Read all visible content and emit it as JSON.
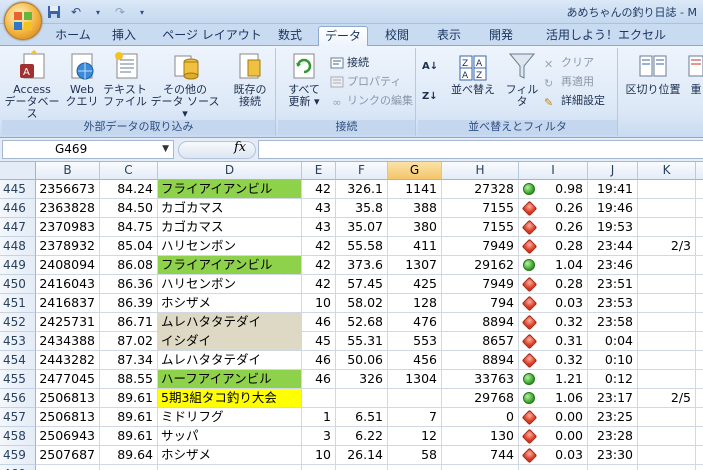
{
  "window": {
    "title": "あめちゃんの釣り日誌 - M"
  },
  "qat_icons": [
    "save-icon",
    "undo-icon",
    "redo-icon",
    "customize-icon"
  ],
  "tabs": [
    "ホーム",
    "挿入",
    "ページ レイアウト",
    "数式",
    "データ",
    "校閲",
    "表示",
    "開発",
    "活用しよう！エクセル"
  ],
  "active_tab": "データ",
  "ribbon": {
    "external": {
      "label": "外部データの取り込み",
      "access_l1": "Access",
      "access_l2": "データベース",
      "web_l1": "Web",
      "web_l2": "クエリ",
      "text_l1": "テキスト",
      "text_l2": "ファイル",
      "other_l1": "その他の",
      "other_l2": "データ ソース ▾",
      "existing_l1": "既存の",
      "existing_l2": "接続"
    },
    "connections": {
      "label": "接続",
      "refresh_l1": "すべて",
      "refresh_l2": "更新 ▾",
      "conn": "接続",
      "props": "プロパティ",
      "links": "リンクの編集"
    },
    "sort": {
      "label": "並べ替えとフィルタ",
      "sort_btn": "並べ替え",
      "filter": "フィルタ",
      "clear": "クリア",
      "reapply": "再適用",
      "advanced": "詳細設定"
    },
    "tools": {
      "split": "区切り位置",
      "dup": "重"
    }
  },
  "formula": {
    "cell_ref": "G469",
    "fx": "fx",
    "value": ""
  },
  "columns": [
    "B",
    "C",
    "D",
    "E",
    "F",
    "G",
    "H",
    "I",
    "J",
    "K"
  ],
  "selected_column": "G",
  "rows": [
    {
      "n": "445",
      "b": "2356673",
      "c": "84.24",
      "d": "フライアイアンビル",
      "dc": "green",
      "e": "42",
      "f": "326.1",
      "g": "1141",
      "h": "27328",
      "dir": "up",
      "i": "0.98",
      "j": "19:41",
      "k": ""
    },
    {
      "n": "446",
      "b": "2363828",
      "c": "84.50",
      "d": "カゴカマス",
      "dc": "",
      "e": "43",
      "f": "35.8",
      "g": "388",
      "h": "7155",
      "dir": "down",
      "i": "0.26",
      "j": "19:46",
      "k": ""
    },
    {
      "n": "447",
      "b": "2370983",
      "c": "84.75",
      "d": "カゴカマス",
      "dc": "",
      "e": "43",
      "f": "35.07",
      "g": "380",
      "h": "7155",
      "dir": "down",
      "i": "0.26",
      "j": "19:53",
      "k": ""
    },
    {
      "n": "448",
      "b": "2378932",
      "c": "85.04",
      "d": "ハリセンボン",
      "dc": "",
      "e": "42",
      "f": "55.58",
      "g": "411",
      "h": "7949",
      "dir": "down",
      "i": "0.28",
      "j": "23:44",
      "k": "2/3"
    },
    {
      "n": "449",
      "b": "2408094",
      "c": "86.08",
      "d": "フライアイアンビル",
      "dc": "green",
      "e": "42",
      "f": "373.6",
      "g": "1307",
      "h": "29162",
      "dir": "up",
      "i": "1.04",
      "j": "23:46",
      "k": ""
    },
    {
      "n": "450",
      "b": "2416043",
      "c": "86.36",
      "d": "ハリセンボン",
      "dc": "",
      "e": "42",
      "f": "57.45",
      "g": "425",
      "h": "7949",
      "dir": "down",
      "i": "0.28",
      "j": "23:51",
      "k": ""
    },
    {
      "n": "451",
      "b": "2416837",
      "c": "86.39",
      "d": "ホシザメ",
      "dc": "",
      "e": "10",
      "f": "58.02",
      "g": "128",
      "h": "794",
      "dir": "down",
      "i": "0.03",
      "j": "23:53",
      "k": ""
    },
    {
      "n": "452",
      "b": "2425731",
      "c": "86.71",
      "d": "ムレハタタテダイ",
      "dc": "tan",
      "e": "46",
      "f": "52.68",
      "g": "476",
      "h": "8894",
      "dir": "down",
      "i": "0.32",
      "j": "23:58",
      "k": ""
    },
    {
      "n": "453",
      "b": "2434388",
      "c": "87.02",
      "d": "イシダイ",
      "dc": "tan",
      "e": "45",
      "f": "55.31",
      "g": "553",
      "h": "8657",
      "dir": "down",
      "i": "0.31",
      "j": "0:04",
      "k": ""
    },
    {
      "n": "454",
      "b": "2443282",
      "c": "87.34",
      "d": "ムレハタタテダイ",
      "dc": "",
      "e": "46",
      "f": "50.06",
      "g": "456",
      "h": "8894",
      "dir": "down",
      "i": "0.32",
      "j": "0:10",
      "k": ""
    },
    {
      "n": "455",
      "b": "2477045",
      "c": "88.55",
      "d": "ハーフアイアンビル",
      "dc": "green",
      "e": "46",
      "f": "326",
      "g": "1304",
      "h": "33763",
      "dir": "up",
      "i": "1.21",
      "j": "0:12",
      "k": ""
    },
    {
      "n": "456",
      "b": "2506813",
      "c": "89.61",
      "d": "5期3組タコ釣り大会",
      "dc": "yellow",
      "e": "",
      "f": "",
      "g": "",
      "h": "29768",
      "dir": "up",
      "i": "1.06",
      "j": "23:17",
      "k": "2/5"
    },
    {
      "n": "457",
      "b": "2506813",
      "c": "89.61",
      "d": "ミドリフグ",
      "dc": "",
      "e": "1",
      "f": "6.51",
      "g": "7",
      "h": "0",
      "dir": "down",
      "i": "0.00",
      "j": "23:25",
      "k": ""
    },
    {
      "n": "458",
      "b": "2506943",
      "c": "89.61",
      "d": "サッパ",
      "dc": "",
      "e": "3",
      "f": "6.22",
      "g": "12",
      "h": "130",
      "dir": "down",
      "i": "0.00",
      "j": "23:28",
      "k": ""
    },
    {
      "n": "459",
      "b": "2507687",
      "c": "89.64",
      "d": "ホシザメ",
      "dc": "",
      "e": "10",
      "f": "26.14",
      "g": "58",
      "h": "744",
      "dir": "down",
      "i": "0.03",
      "j": "23:30",
      "k": ""
    },
    {
      "n": "460",
      "b": "",
      "c": "",
      "d": "",
      "dc": "",
      "e": "",
      "f": "",
      "g": "",
      "h": "",
      "dir": "",
      "i": "",
      "j": "",
      "k": ""
    }
  ],
  "colors": {
    "green": "#8ed14a",
    "tan": "#ddd9c4",
    "yellow": "#ffff00",
    "selected_col": "#f4c56a"
  }
}
